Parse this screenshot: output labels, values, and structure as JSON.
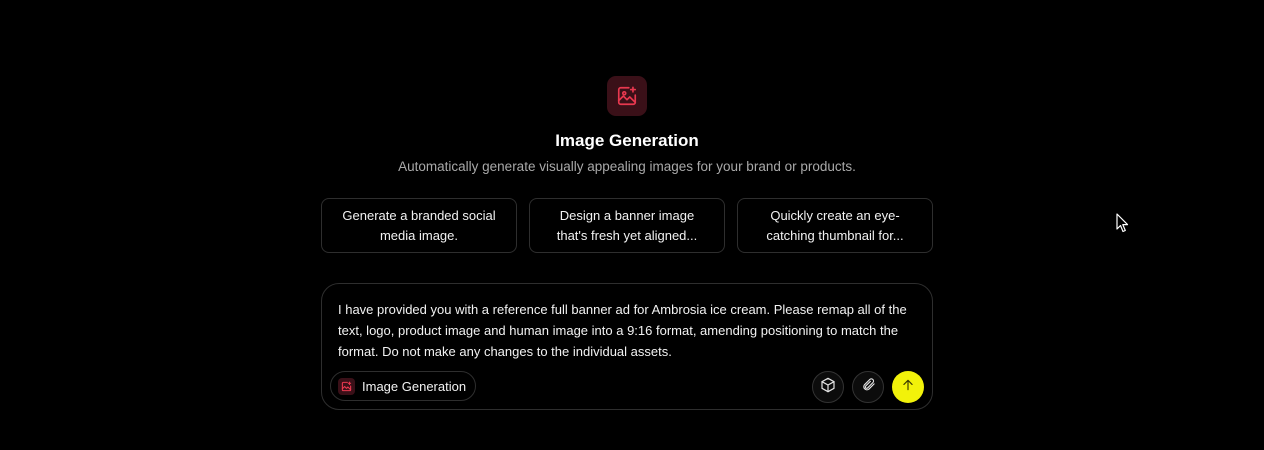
{
  "hero": {
    "icon": "image-sparkle-icon",
    "title": "Image Generation",
    "subtitle": "Automatically generate visually appealing images for your brand or products."
  },
  "suggestions": [
    {
      "label": "Generate a branded social media image."
    },
    {
      "label": "Design a banner image that's fresh yet aligned..."
    },
    {
      "label": "Quickly create an eye-catching thumbnail for..."
    }
  ],
  "composer": {
    "prompt": "I have provided you with a reference full banner ad for Ambrosia ice cream. Please remap all of the text, logo, product image and human image into a 9:16 format, amending positioning to match the format. Do not make any changes to the individual assets.",
    "mode_chip": {
      "label": "Image Generation",
      "icon": "image-sparkle-icon"
    },
    "buttons": [
      {
        "name": "model-button",
        "icon": "cube-icon"
      },
      {
        "name": "attach-button",
        "icon": "paperclip-icon"
      },
      {
        "name": "send-button",
        "icon": "arrow-up-icon"
      }
    ]
  },
  "colors": {
    "background": "#000000",
    "accent_red": "#e8384f",
    "send_yellow": "#f2f20a",
    "border": "#2e2e2e",
    "muted_text": "#a9a9a9"
  }
}
